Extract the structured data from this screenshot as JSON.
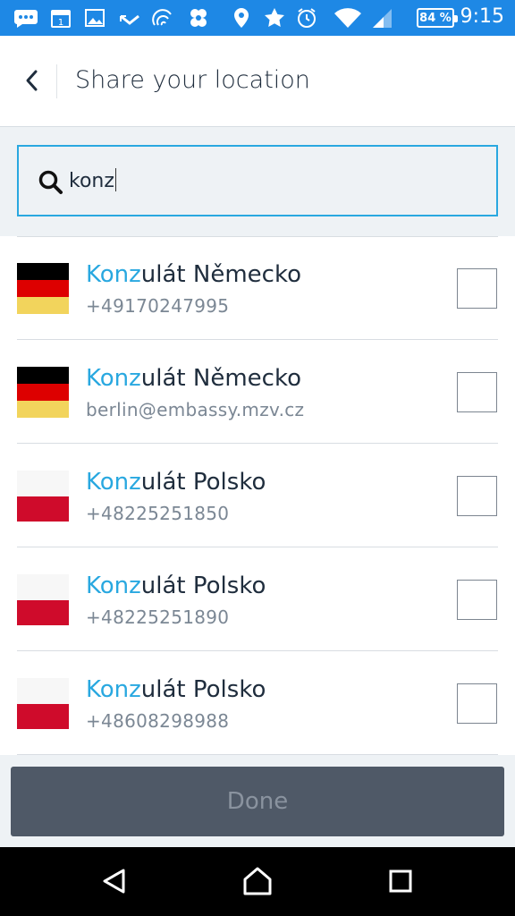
{
  "status_bar": {
    "battery": "84 %",
    "time": "9:15",
    "icons": [
      "chat-icon",
      "calendar-icon",
      "image-icon",
      "missed-call-icon",
      "nfc-icon",
      "bug-icon",
      "location-icon",
      "star-icon",
      "alarm-icon",
      "wifi-icon",
      "signal-icon"
    ],
    "calendar_day": "1",
    "background_color": "#1E88E5"
  },
  "header": {
    "title": "Share your location"
  },
  "search": {
    "value": "konz",
    "accent_color": "#29a8e0"
  },
  "contacts": [
    {
      "highlight": "Konz",
      "rest": "ulát Německo",
      "detail": "+49170247995",
      "flag": "germany",
      "checked": false
    },
    {
      "highlight": "Konz",
      "rest": "ulát Německo",
      "detail": "berlin@embassy.mzv.cz",
      "flag": "germany",
      "checked": false
    },
    {
      "highlight": "Konz",
      "rest": "ulát Polsko",
      "detail": "+48225251850",
      "flag": "poland",
      "checked": false
    },
    {
      "highlight": "Konz",
      "rest": "ulát Polsko",
      "detail": "+48225251890",
      "flag": "poland",
      "checked": false
    },
    {
      "highlight": "Konz",
      "rest": "ulát Polsko",
      "detail": "+48608298988",
      "flag": "poland",
      "checked": false
    }
  ],
  "footer": {
    "done_label": "Done"
  },
  "nav": {
    "icons": [
      "back-triangle-icon",
      "home-icon",
      "recents-icon"
    ]
  }
}
